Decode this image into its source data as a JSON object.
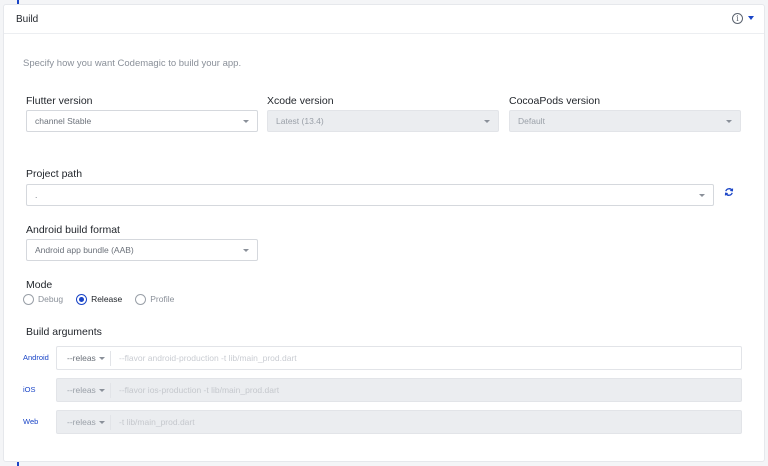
{
  "header": {
    "title": "Build",
    "info_icon": "info-icon",
    "caret_icon": "caret-down-icon"
  },
  "intro": "Specify how you want Codemagic to build your app.",
  "flutter": {
    "label": "Flutter version",
    "value": "channel Stable"
  },
  "xcode": {
    "label": "Xcode version",
    "value": "Latest (13.4)",
    "disabled": true
  },
  "cocoapods": {
    "label": "CocoaPods version",
    "value": "Default",
    "disabled": true
  },
  "project_path": {
    "label": "Project path",
    "value": ".",
    "refresh_icon": "refresh-icon"
  },
  "android_format": {
    "label": "Android build format",
    "value": "Android app bundle (AAB)"
  },
  "mode": {
    "label": "Mode",
    "options": [
      {
        "label": "Debug",
        "checked": false
      },
      {
        "label": "Release",
        "checked": true
      },
      {
        "label": "Profile",
        "checked": false
      }
    ]
  },
  "build_arguments": {
    "label": "Build arguments",
    "rows": [
      {
        "platform": "Android",
        "mode": "--releas",
        "placeholder": "--flavor android-production -t lib/main_prod.dart",
        "disabled": false
      },
      {
        "platform": "iOS",
        "mode": "--releas",
        "placeholder": "--flavor ios-production -t lib/main_prod.dart",
        "disabled": true
      },
      {
        "platform": "Web",
        "mode": "--releas",
        "placeholder": "-t lib/main_prod.dart",
        "disabled": true
      }
    ]
  },
  "colors": {
    "accent": "#1a45c7",
    "disabled_bg": "#ebedf0"
  }
}
